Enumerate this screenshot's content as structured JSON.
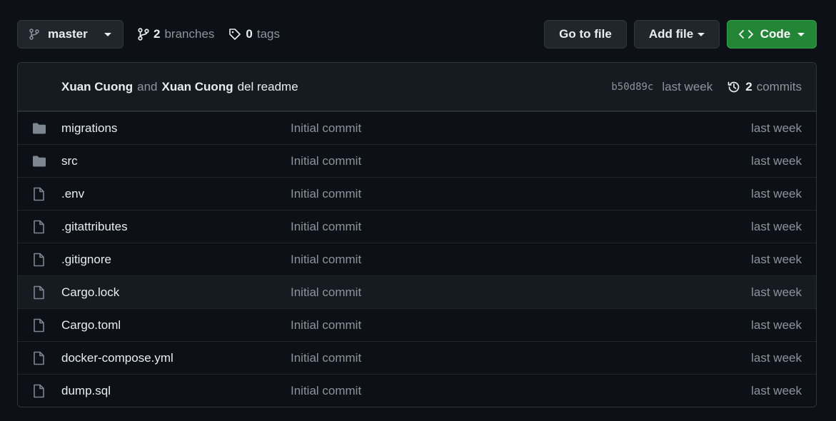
{
  "toolbar": {
    "branch": "master",
    "branches_count": "2",
    "branches_label": "branches",
    "tags_count": "0",
    "tags_label": "tags",
    "goto_file": "Go to file",
    "add_file": "Add file",
    "code": "Code"
  },
  "commit": {
    "author1": "Xuan Cuong",
    "and": "and",
    "author2": "Xuan Cuong",
    "message": "del readme",
    "sha": "b50d89c",
    "when": "last week",
    "commits_count": "2",
    "commits_label": "commits"
  },
  "files": [
    {
      "type": "folder",
      "name": "migrations",
      "message": "Initial commit",
      "age": "last week"
    },
    {
      "type": "folder",
      "name": "src",
      "message": "Initial commit",
      "age": "last week"
    },
    {
      "type": "file",
      "name": ".env",
      "message": "Initial commit",
      "age": "last week"
    },
    {
      "type": "file",
      "name": ".gitattributes",
      "message": "Initial commit",
      "age": "last week"
    },
    {
      "type": "file",
      "name": ".gitignore",
      "message": "Initial commit",
      "age": "last week"
    },
    {
      "type": "file",
      "name": "Cargo.lock",
      "message": "Initial commit",
      "age": "last week"
    },
    {
      "type": "file",
      "name": "Cargo.toml",
      "message": "Initial commit",
      "age": "last week"
    },
    {
      "type": "file",
      "name": "docker-compose.yml",
      "message": "Initial commit",
      "age": "last week"
    },
    {
      "type": "file",
      "name": "dump.sql",
      "message": "Initial commit",
      "age": "last week"
    }
  ],
  "colors": {
    "background": "#0d1117",
    "primary_button": "#238636",
    "muted_text": "#8b949e"
  },
  "icons": {
    "branch": "git-branch-icon",
    "tag": "tag-icon",
    "code": "code-icon",
    "history": "history-icon",
    "folder": "folder-icon",
    "file": "file-icon"
  }
}
